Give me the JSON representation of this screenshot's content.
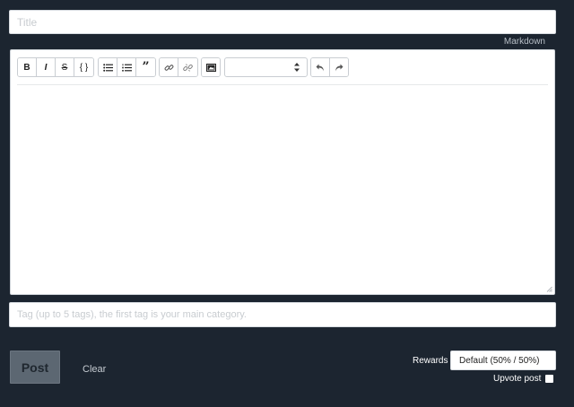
{
  "title_field": {
    "placeholder": "Title",
    "value": ""
  },
  "editor_mode": {
    "markdown_label": "Markdown"
  },
  "toolbar": {
    "groups": [
      {
        "buttons": [
          {
            "glyph": "B",
            "icon": "bold-icon"
          },
          {
            "glyph": "I",
            "icon": "italic-icon"
          },
          {
            "glyph": "S",
            "icon": "strikethrough-icon"
          },
          {
            "glyph": "{ }",
            "icon": "code-icon"
          }
        ]
      },
      {
        "buttons": [
          {
            "glyph": "",
            "icon": "bullet-list-icon"
          },
          {
            "glyph": "",
            "icon": "numbered-list-icon"
          },
          {
            "glyph": "”",
            "icon": "quote-icon"
          }
        ]
      },
      {
        "buttons": [
          {
            "glyph": "",
            "icon": "link-icon"
          },
          {
            "glyph": "",
            "icon": "unlink-icon"
          }
        ]
      },
      {
        "buttons": [
          {
            "glyph": "",
            "icon": "image-icon"
          }
        ]
      },
      {
        "buttons": [
          {
            "glyph": "",
            "icon": "undo-icon"
          },
          {
            "glyph": "",
            "icon": "redo-icon"
          }
        ]
      }
    ],
    "heading_select": {
      "value": ""
    }
  },
  "body": {
    "value": ""
  },
  "tags_field": {
    "placeholder": "Tag (up to 5 tags), the first tag is your main category.",
    "value": ""
  },
  "actions": {
    "post_label": "Post",
    "clear_label": "Clear"
  },
  "rewards": {
    "label": "Rewards",
    "selected": "Default (50% / 50%)"
  },
  "upvote": {
    "label": "Upvote post",
    "checked": false
  },
  "colors": {
    "background": "#1c2530",
    "post_button": "#5c6772"
  }
}
